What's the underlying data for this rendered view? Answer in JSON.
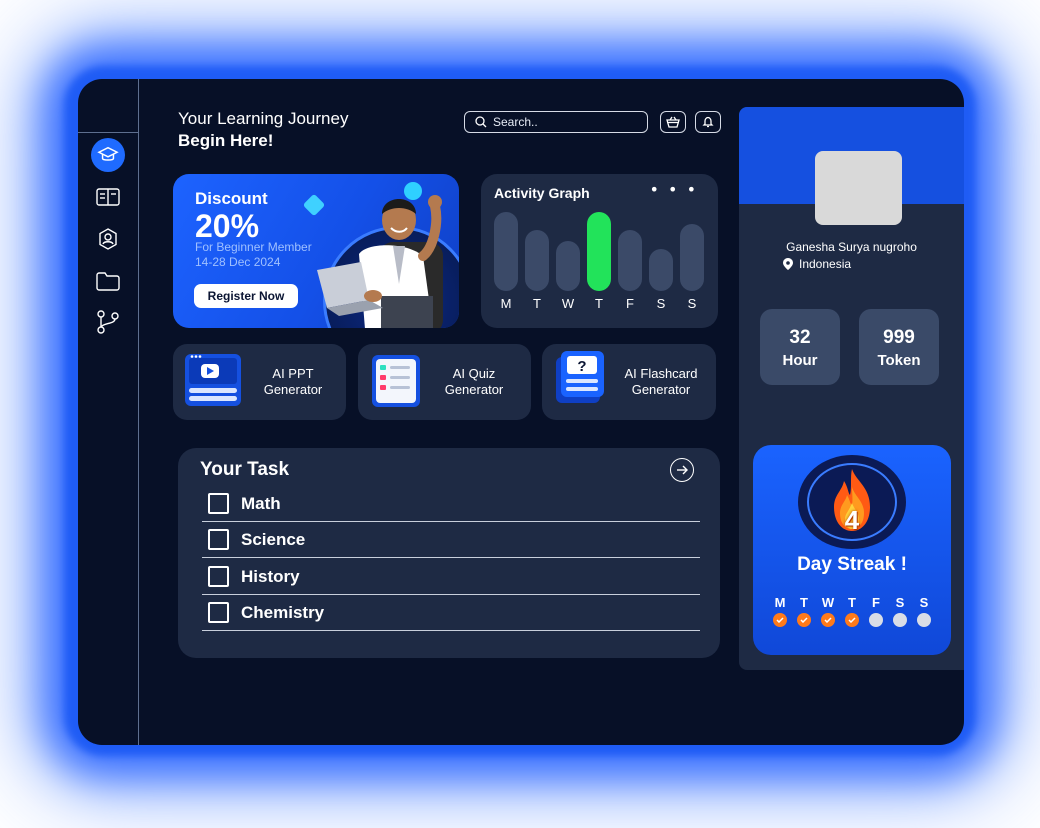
{
  "header": {
    "line1": "Your Learning Journey",
    "line2": "Begin Here!",
    "search_placeholder": "Search.."
  },
  "sidebar": {
    "items": [
      {
        "icon": "graduation-cap-icon",
        "active": true
      },
      {
        "icon": "book-icon",
        "active": false
      },
      {
        "icon": "profile-icon",
        "active": false
      },
      {
        "icon": "folder-icon",
        "active": false
      },
      {
        "icon": "branch-icon",
        "active": false
      }
    ]
  },
  "promo": {
    "title": "Discount",
    "percent": "20%",
    "desc": "For Beginner Member 14-28 Dec 2024",
    "cta": "Register Now"
  },
  "activity": {
    "title": "Activity Graph",
    "more": "• • •",
    "days": [
      "M",
      "T",
      "W",
      "T",
      "F",
      "S",
      "S"
    ],
    "highlight_day_index": 3,
    "highlight_color": "#22e35a"
  },
  "tools": [
    {
      "label": "AI PPT Generator"
    },
    {
      "label": "AI Quiz Generator"
    },
    {
      "label": "AI Flashcard Generator"
    }
  ],
  "task": {
    "title": "Your Task",
    "items": [
      "Math",
      "Science",
      "History",
      "Chemistry"
    ]
  },
  "profile": {
    "name": "Ganesha Surya nugroho",
    "location": "Indonesia",
    "stats": [
      {
        "value": "32",
        "unit": "Hour"
      },
      {
        "value": "999",
        "unit": "Token"
      }
    ]
  },
  "streak": {
    "count": "4",
    "label": "Day Streak !",
    "days": [
      "M",
      "T",
      "W",
      "T",
      "F",
      "S",
      "S"
    ],
    "completed": [
      true,
      true,
      true,
      true,
      false,
      false,
      false
    ],
    "done_color": "#ff7a1a",
    "pending_color": "#d9dde6"
  }
}
